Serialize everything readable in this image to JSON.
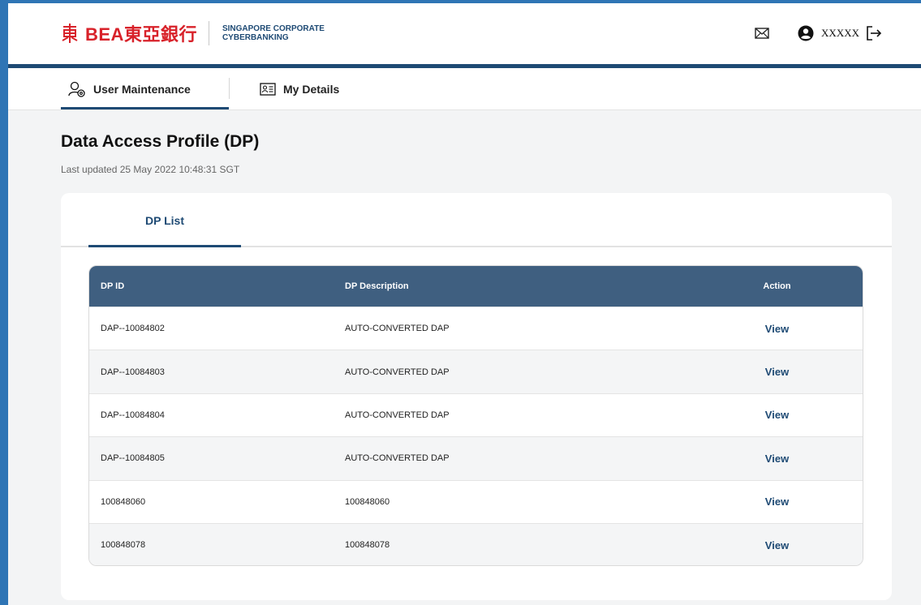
{
  "header": {
    "logo_text": "BEA東亞銀行",
    "subtitle_line1": "SINGAPORE CORPORATE",
    "subtitle_line2": "CYBERBANKING",
    "username": "XXXXX",
    "icons": [
      "mail-icon",
      "user-icon",
      "logout-icon"
    ]
  },
  "nav": {
    "tabs": [
      {
        "label": "User Maintenance",
        "icon": "user-settings-icon",
        "active": true
      },
      {
        "label": "My Details",
        "icon": "id-card-icon",
        "active": false
      }
    ]
  },
  "page": {
    "title": "Data Access Profile (DP)",
    "last_updated": "Last updated 25 May 2022 10:48:31 SGT"
  },
  "card": {
    "tab_label": "DP List"
  },
  "table": {
    "columns": [
      "DP ID",
      "DP Description",
      "Action"
    ],
    "rows": [
      {
        "id": "DAP--10084802",
        "description": "AUTO-CONVERTED DAP",
        "action": "View"
      },
      {
        "id": "DAP--10084803",
        "description": "AUTO-CONVERTED DAP",
        "action": "View"
      },
      {
        "id": "DAP--10084804",
        "description": "AUTO-CONVERTED DAP",
        "action": "View"
      },
      {
        "id": "DAP--10084805",
        "description": "AUTO-CONVERTED DAP",
        "action": "View"
      },
      {
        "id": "100848060",
        "description": "100848060",
        "action": "View"
      },
      {
        "id": "100848078",
        "description": "100848078",
        "action": "View"
      }
    ]
  },
  "colors": {
    "brand_red": "#d8222a",
    "brand_navy": "#1e4a74",
    "table_header": "#3f5f80",
    "frame_blue": "#2f75b5"
  }
}
